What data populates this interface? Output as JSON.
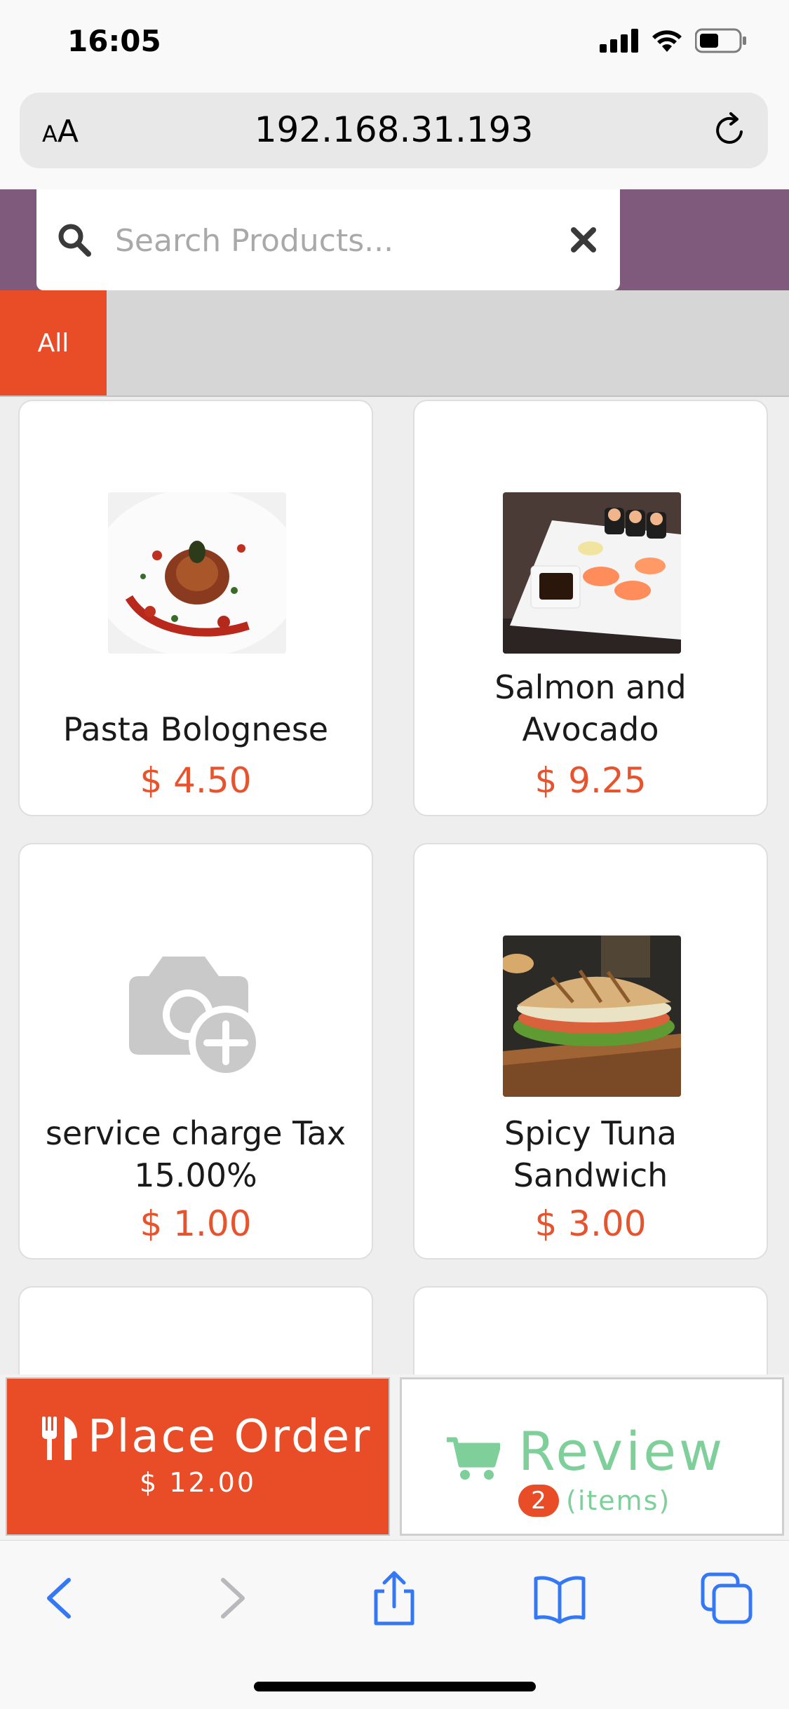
{
  "status_bar": {
    "time": "16:05"
  },
  "browser": {
    "aa_label_small": "A",
    "aa_label": "A",
    "url": "192.168.31.193"
  },
  "search": {
    "placeholder": "Search Products..."
  },
  "categories": [
    {
      "label": "All",
      "active": true
    }
  ],
  "products": [
    {
      "name": "Pasta Bolognese",
      "price": "$ 4.50",
      "image": "pasta-photo"
    },
    {
      "name": "Salmon and Avocado",
      "price": "$ 9.25",
      "image": "sushi-photo"
    },
    {
      "name": "service charge Tax 15.00%",
      "price": "$ 1.00",
      "image": "add-photo-icon"
    },
    {
      "name": "Spicy Tuna Sandwich",
      "price": "$ 3.00",
      "image": "sandwich-photo"
    }
  ],
  "actions": {
    "place_order_label": "Place Order",
    "order_total": "$ 12.00",
    "review_label": "Review",
    "review_count": "2",
    "review_items_label": "(items)"
  },
  "colors": {
    "accent": "#e84d27",
    "header": "#7f5a7c",
    "review_green": "#7ecf9a",
    "ios_blue": "#3478f6"
  }
}
